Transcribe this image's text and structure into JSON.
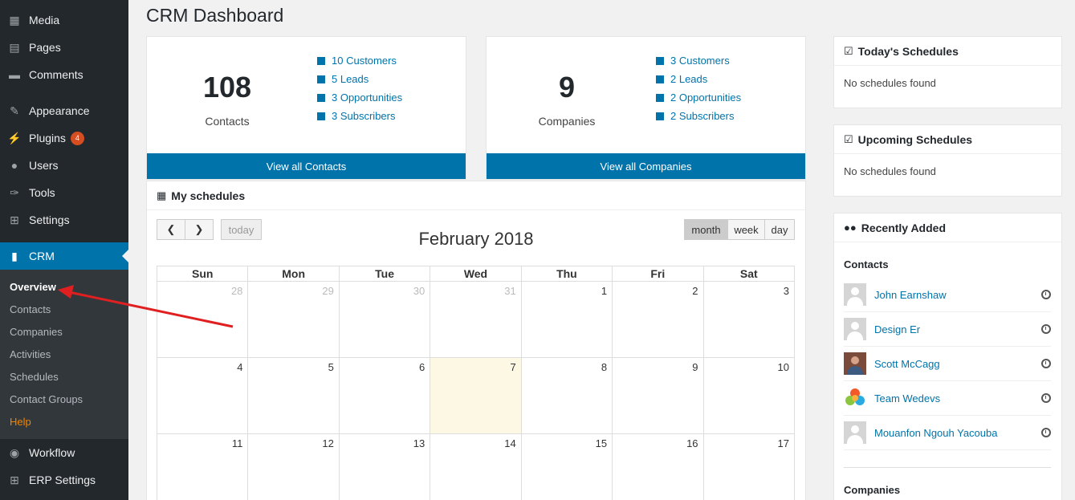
{
  "sidebar": {
    "items": [
      {
        "label": "Media",
        "icon": "media-icon"
      },
      {
        "label": "Pages",
        "icon": "pages-icon"
      },
      {
        "label": "Comments",
        "icon": "comments-icon"
      },
      {
        "label": "Appearance",
        "icon": "appearance-icon"
      },
      {
        "label": "Plugins",
        "icon": "plugins-icon",
        "badge": "4"
      },
      {
        "label": "Users",
        "icon": "users-icon"
      },
      {
        "label": "Tools",
        "icon": "tools-icon"
      },
      {
        "label": "Settings",
        "icon": "settings-icon"
      },
      {
        "label": "CRM",
        "icon": "chart-icon"
      },
      {
        "label": "Workflow",
        "icon": "workflow-icon"
      },
      {
        "label": "ERP Settings",
        "icon": "erp-settings-icon"
      }
    ],
    "submenu": [
      "Overview",
      "Contacts",
      "Companies",
      "Activities",
      "Schedules",
      "Contact Groups",
      "Help"
    ]
  },
  "page": {
    "title": "CRM Dashboard"
  },
  "contacts_card": {
    "count": "108",
    "label": "Contacts",
    "links": [
      "10 Customers",
      "5 Leads",
      "3 Opportunities",
      "3 Subscribers"
    ],
    "view_all": "View all Contacts"
  },
  "companies_card": {
    "count": "9",
    "label": "Companies",
    "links": [
      "3 Customers",
      "2 Leads",
      "2 Opportunities",
      "2 Subscribers"
    ],
    "view_all": "View all Companies"
  },
  "schedules": {
    "title": "My schedules",
    "today_btn": "today",
    "month_title": "February 2018",
    "views": [
      "month",
      "week",
      "day"
    ],
    "weekdays": [
      "Sun",
      "Mon",
      "Tue",
      "Wed",
      "Thu",
      "Fri",
      "Sat"
    ],
    "weeks": [
      [
        "28",
        "29",
        "30",
        "31",
        "1",
        "2",
        "3"
      ],
      [
        "4",
        "5",
        "6",
        "7",
        "8",
        "9",
        "10"
      ],
      [
        "11",
        "12",
        "13",
        "14",
        "15",
        "16",
        "17"
      ]
    ]
  },
  "today_schedules": {
    "title": "Today's Schedules",
    "empty": "No schedules found"
  },
  "upcoming_schedules": {
    "title": "Upcoming Schedules",
    "empty": "No schedules found"
  },
  "recently_added": {
    "title": "Recently Added",
    "contacts_label": "Contacts",
    "contacts": [
      "John Earnshaw",
      "Design Er",
      "Scott McCagg",
      "Team Wedevs",
      "Mouanfon Ngouh Yacouba"
    ],
    "companies_label": "Companies"
  },
  "colors": {
    "accent": "#0073aa",
    "sidebar": "#23282d",
    "today_cell": "#fcf8e3",
    "arrow": "#e02020"
  }
}
